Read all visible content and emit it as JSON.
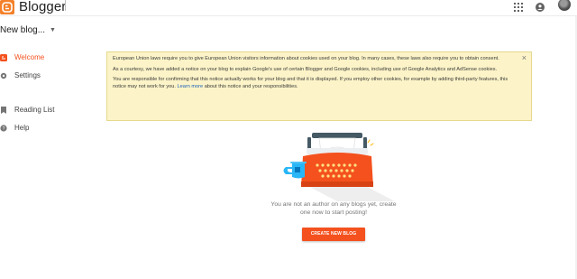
{
  "app": {
    "name": "Blogger",
    "logo_icon": "blogger-logo-icon",
    "brand_color": "#f4802a"
  },
  "header": {
    "apps_icon": "apps-grid-icon",
    "account_icon": "account-circle-icon",
    "avatar_icon": "user-avatar"
  },
  "blog_selector": {
    "label": "New blog...",
    "caret_icon": "caret-down-icon"
  },
  "sidebar": {
    "items": [
      {
        "label": "Welcome",
        "icon": "blogger-icon",
        "active": true
      },
      {
        "label": "Settings",
        "icon": "gear-icon"
      },
      {
        "label": "Reading List",
        "icon": "bookmark-icon"
      },
      {
        "label": "Help",
        "icon": "help-icon"
      }
    ],
    "active_color": "#f4511e"
  },
  "notice": {
    "paragraph1": "European Union laws require you to give European Union visitors information about cookies used on your blog. In many cases, these laws also require you to obtain consent.",
    "paragraph2": "As a courtesy, we have added a notice on your blog to explain Google's use of certain Blogger and Google cookies, including use of Google Analytics and AdSense cookies.",
    "paragraph3_before": "You are responsible for confirming that this notice actually works for your blog and that it is displayed. If you employ other cookies, for example by adding third-party features, this notice may not work for you.",
    "learn_more": "Learn more",
    "paragraph3_after": "about this notice and your responsibilities.",
    "close_label": "×",
    "background": "#fcf4c8"
  },
  "empty_state": {
    "message_line1": "You are not an author on any blogs yet, create",
    "message_line2": "one now to start posting!",
    "illustration_icon": "typewriter-illustration",
    "create_button": "CREATE NEW BLOG",
    "button_color": "#f4511e"
  }
}
